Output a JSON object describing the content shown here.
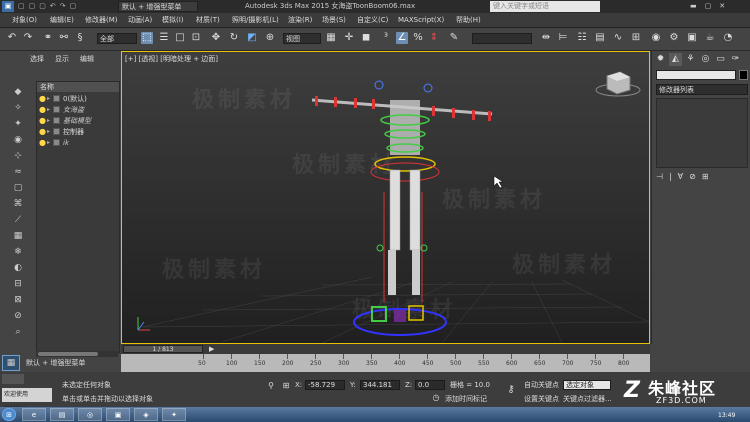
{
  "titlebar": {
    "workspace": "默认 + 增强型菜单",
    "title": "Autodesk 3ds Max 2015    女海盗ToonBoom06.max",
    "search_placeholder": "键入关键字或短语"
  },
  "menubar": {
    "items": [
      "对象(O)",
      "编辑(E)",
      "修改器(M)",
      "动画(A)",
      "模拟(I)",
      "材质(T)",
      "照明/摄影机(L)",
      "渲染(R)",
      "场景(S)",
      "自定义(C)",
      "MAXScript(X)",
      "帮助(H)"
    ]
  },
  "toolbar": {
    "selection_filter": "全部",
    "reference_coord": "视图",
    "named_selection": ""
  },
  "explorer": {
    "tabs": [
      "选择",
      "显示",
      "编辑"
    ],
    "header": "名称",
    "rows": [
      {
        "label": "0(默认)",
        "italic": false
      },
      {
        "label": "女海盗",
        "italic": true
      },
      {
        "label": "基础模型",
        "italic": true
      },
      {
        "label": "控制器",
        "italic": false
      },
      {
        "label": "ik",
        "italic": true
      }
    ],
    "workspace": "默认 + 增强型菜单"
  },
  "viewport": {
    "label": "[+] [透视] [明暗处理 + 边面]",
    "watermark": "极制素材"
  },
  "cmdpanel": {
    "modifier_list": "修改器列表",
    "color": "#000000"
  },
  "timeline": {
    "frame": "1 / 813",
    "ticks": [
      "50",
      "100",
      "150",
      "200",
      "250",
      "300",
      "350",
      "400",
      "450",
      "500",
      "550",
      "600",
      "650",
      "700",
      "750",
      "800"
    ]
  },
  "status": {
    "workspace": "默认 + 增强型菜单",
    "selection_status": "未选定任何对象",
    "prompt": "单击或单击并拖动以选择对象",
    "welcome": "欢迎使用 MAXScr",
    "x_label": "X:",
    "x_value": "-58.729",
    "y_label": "Y:",
    "y_value": "344.181",
    "z_label": "Z:",
    "z_value": "0.0",
    "grid": "栅格 = 10.0",
    "add_time_tag": "添加时间标记",
    "auto_key": "自动关键点",
    "set_key": "设置关键点",
    "selected": "选定对象",
    "key_filters": "关键点过滤器..."
  },
  "brand": {
    "name": "朱峰社区",
    "url": "ZF3D.COM"
  },
  "clock": "13:49"
}
